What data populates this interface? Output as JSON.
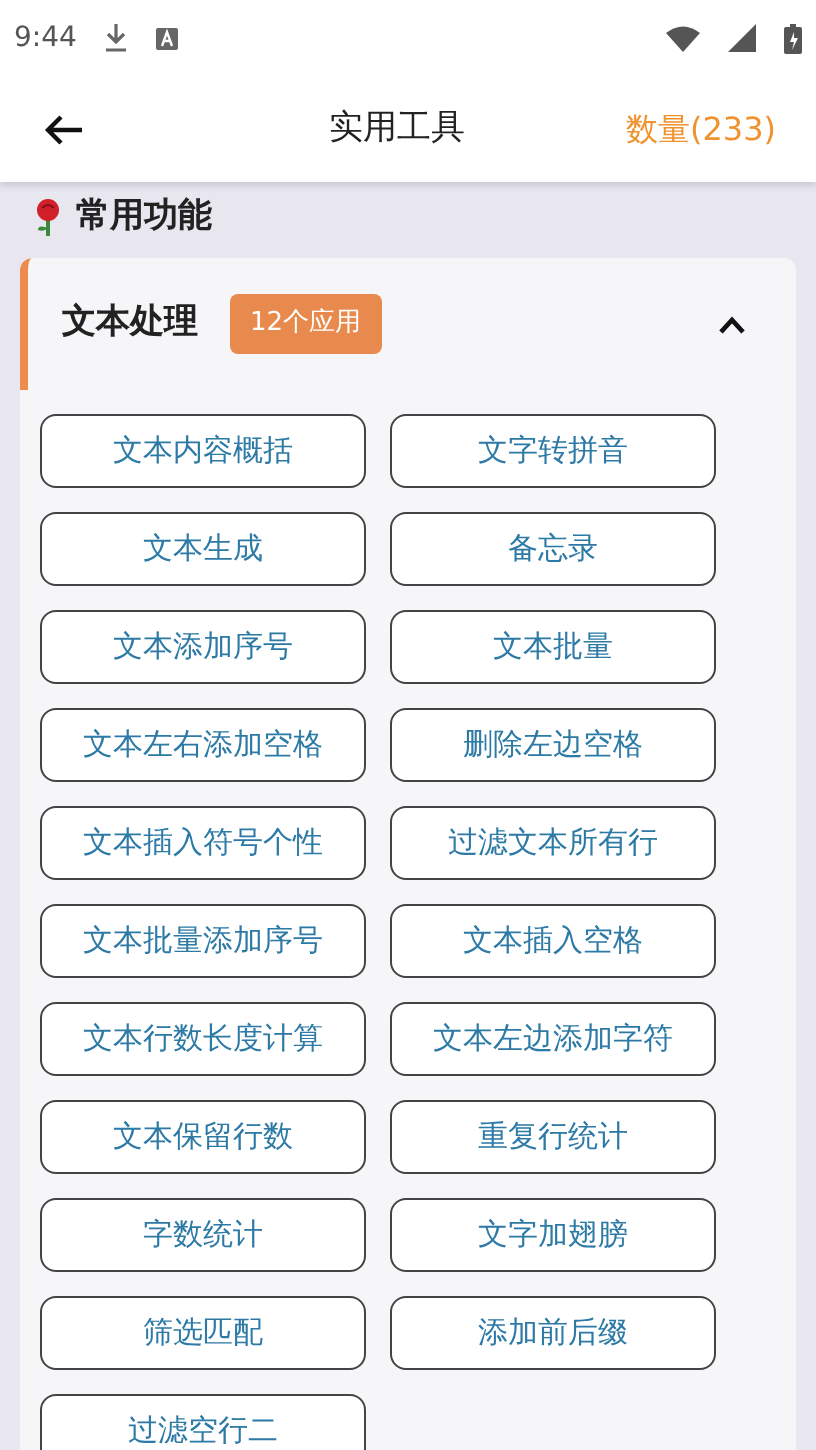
{
  "status_bar": {
    "time": "9:44"
  },
  "header": {
    "title": "实用工具",
    "count": "数量(233)"
  },
  "section": {
    "title": "常用功能"
  },
  "group": {
    "title": "文本处理",
    "badge": "12个应用",
    "expanded": true,
    "tools": [
      {
        "label": "文本内容概括"
      },
      {
        "label": "文字转拼音"
      },
      {
        "label": "文本生成"
      },
      {
        "label": "备忘录"
      },
      {
        "label": "文本添加序号"
      },
      {
        "label": "文本批量"
      },
      {
        "label": "文本左右添加空格"
      },
      {
        "label": "删除左边空格"
      },
      {
        "label": "文本插入符号个性"
      },
      {
        "label": "过滤文本所有行"
      },
      {
        "label": "文本批量添加序号"
      },
      {
        "label": "文本插入空格"
      },
      {
        "label": "文本行数长度计算"
      },
      {
        "label": "文本左边添加字符"
      },
      {
        "label": "文本保留行数"
      },
      {
        "label": "重复行统计"
      },
      {
        "label": "字数统计"
      },
      {
        "label": "文字加翅膀"
      },
      {
        "label": "筛选匹配"
      },
      {
        "label": "添加前后缀"
      },
      {
        "label": "过滤空行二"
      }
    ]
  }
}
